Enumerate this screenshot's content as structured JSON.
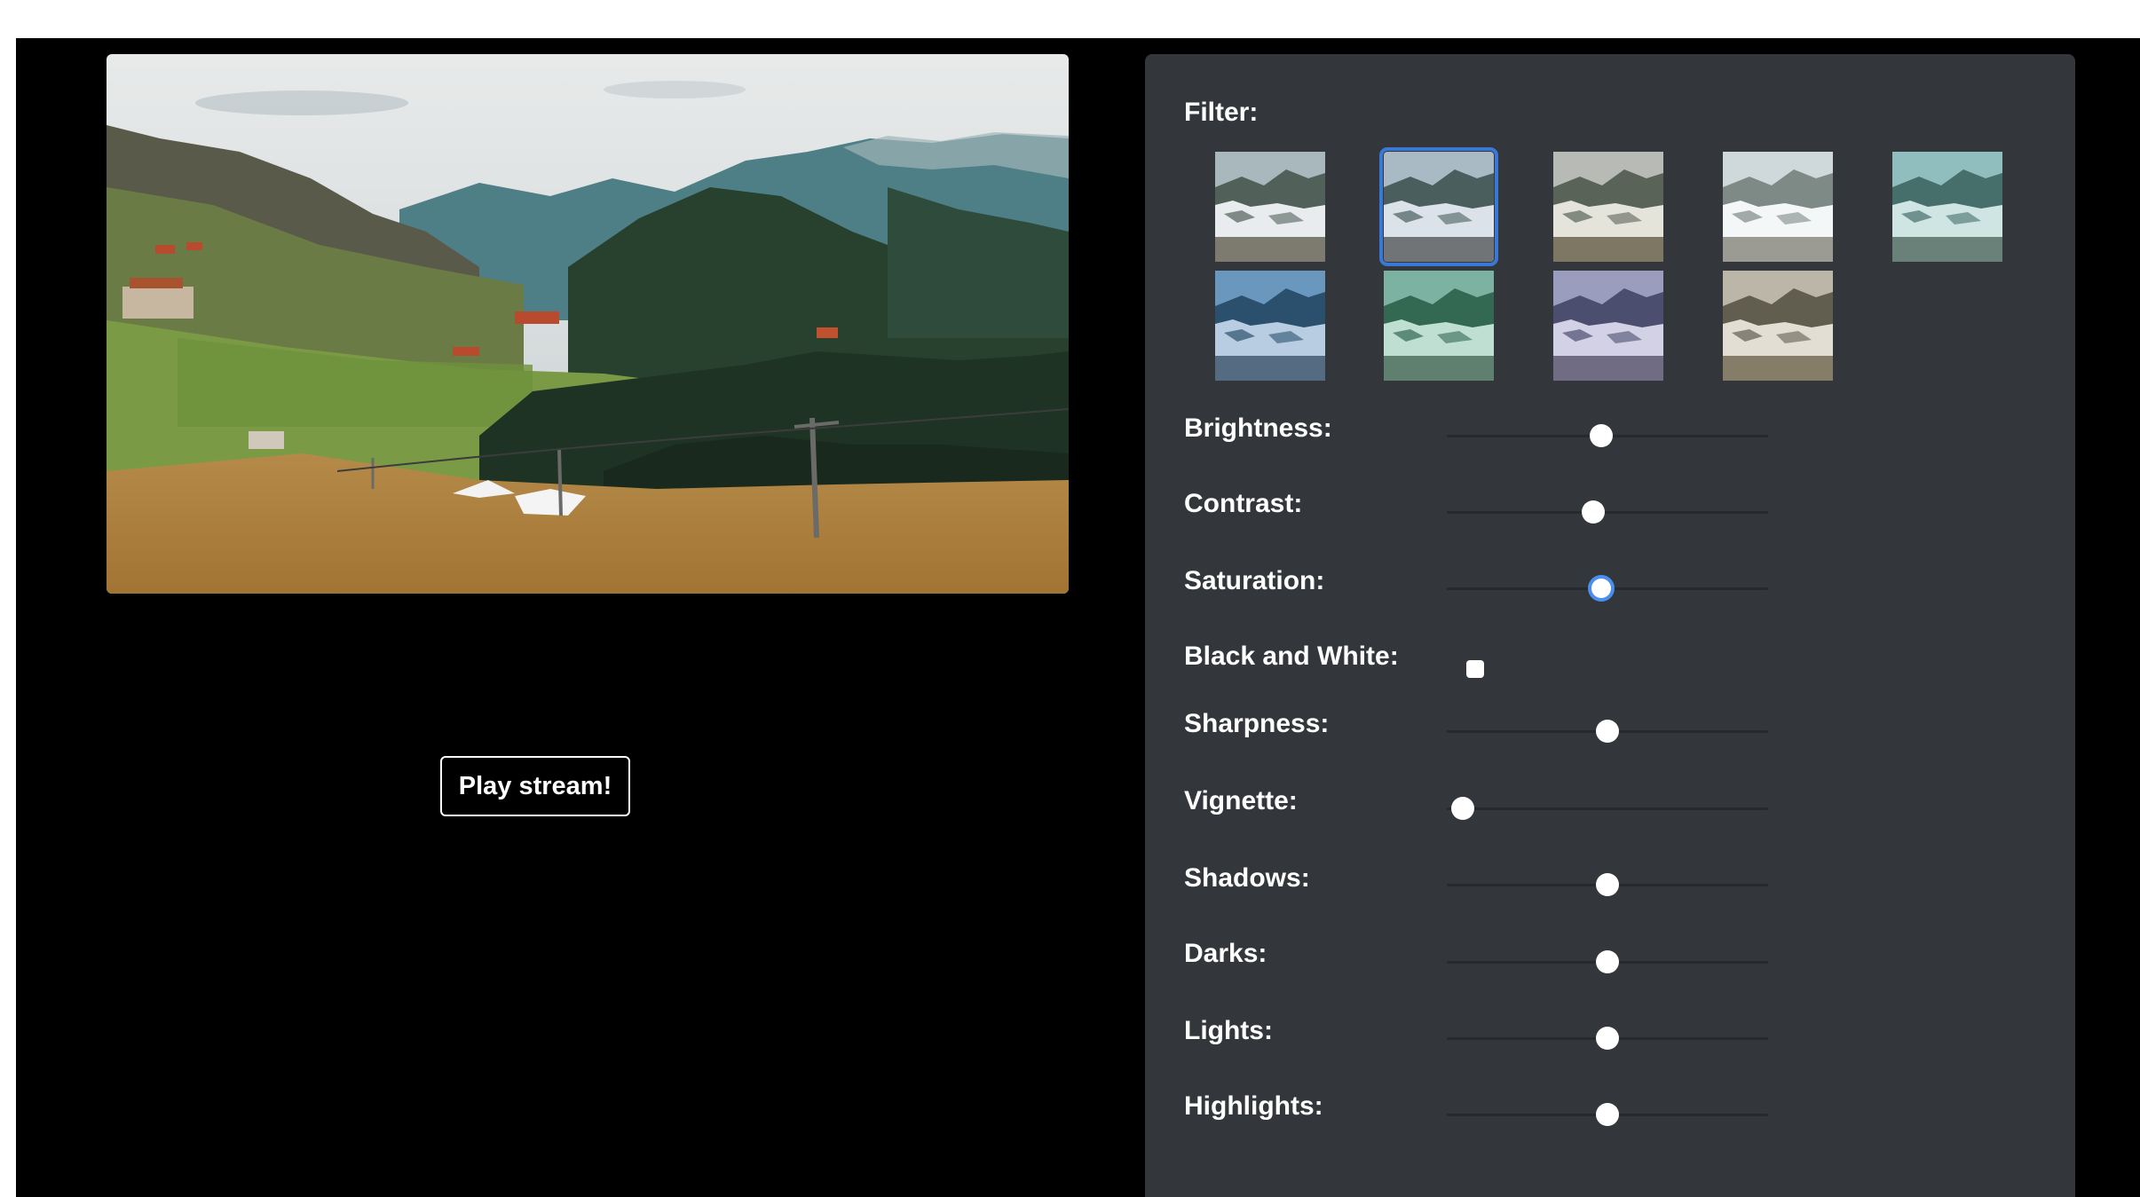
{
  "video": {
    "play_button_label": "Play stream!"
  },
  "panel": {
    "filter_label": "Filter:",
    "filter_thumbnails": [
      {
        "tint": "none"
      },
      {
        "tint": "cool",
        "selected": true
      },
      {
        "tint": "warm"
      },
      {
        "tint": "faded"
      },
      {
        "tint": "teal"
      },
      {
        "tint": "blue"
      },
      {
        "tint": "green"
      },
      {
        "tint": "violet"
      },
      {
        "tint": "sepia"
      }
    ],
    "brightness_label": "Brightness:",
    "contrast_label": "Contrast:",
    "saturation_label": "Saturation:",
    "black_white_label": "Black and White:",
    "sharpness_label": "Sharpness:",
    "vignette_label": "Vignette:",
    "shadows_label": "Shadows:",
    "darks_label": "Darks:",
    "lights_label": "Lights:",
    "highlights_label": "Highlights:",
    "slider_levels": {
      "brightness": 0.48,
      "contrast": 0.455,
      "saturation": 0.48,
      "sharpness": 0.5,
      "vignette": 0.05,
      "shadows": 0.5,
      "darks": 0.5,
      "lights": 0.5,
      "highlights": 0.5
    },
    "black_white_checked": false
  },
  "colors": {
    "panel_bg": "#33363b",
    "selection_outline": "#3a78d8",
    "focus_ring": "#4a8ef0"
  }
}
